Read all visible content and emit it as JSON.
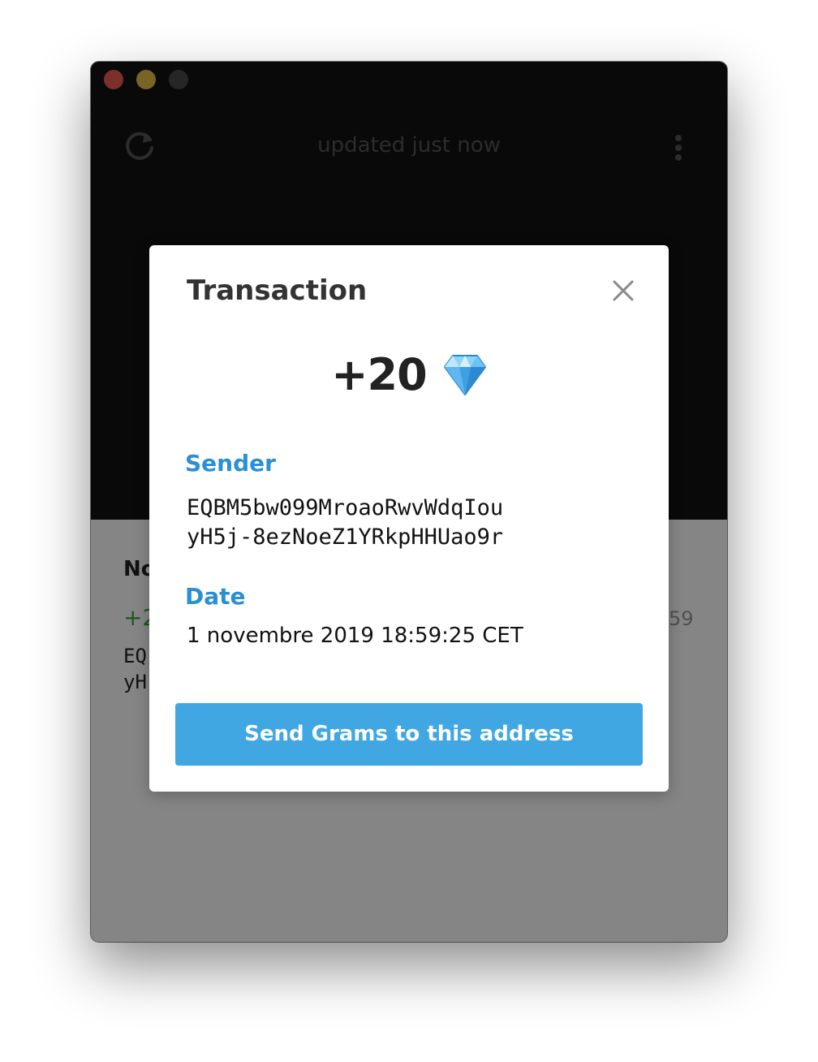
{
  "window": {
    "traffic_lights": {
      "close_color": "#ee5b54",
      "minimize_color": "#e5c04a",
      "zoom_color": "#4a4a4a"
    }
  },
  "header": {
    "refresh_icon": "refresh-icon",
    "status_text": "updated just now",
    "more_icon": "more-vertical-icon"
  },
  "history": {
    "section_title": "No",
    "item": {
      "amount": "+2",
      "time": "59",
      "address": "EQ\nyH"
    }
  },
  "modal": {
    "title": "Transaction",
    "close_icon": "close-icon",
    "amount": "+20",
    "currency_icon": "diamond-icon",
    "sender_label": "Sender",
    "sender_address": "EQBM5bw099MroaoRwvWdqIou\nyH5j-8ezNoeZ1YRkpHHUao9r",
    "date_label": "Date",
    "date_value": "1 novembre 2019 18:59:25 CET",
    "send_button_label": "Send Grams to this address"
  },
  "colors": {
    "accent": "#40a7e3",
    "label_blue": "#2a8fd4",
    "header_bg": "#121212",
    "positive_amount": "#3aa53a"
  }
}
